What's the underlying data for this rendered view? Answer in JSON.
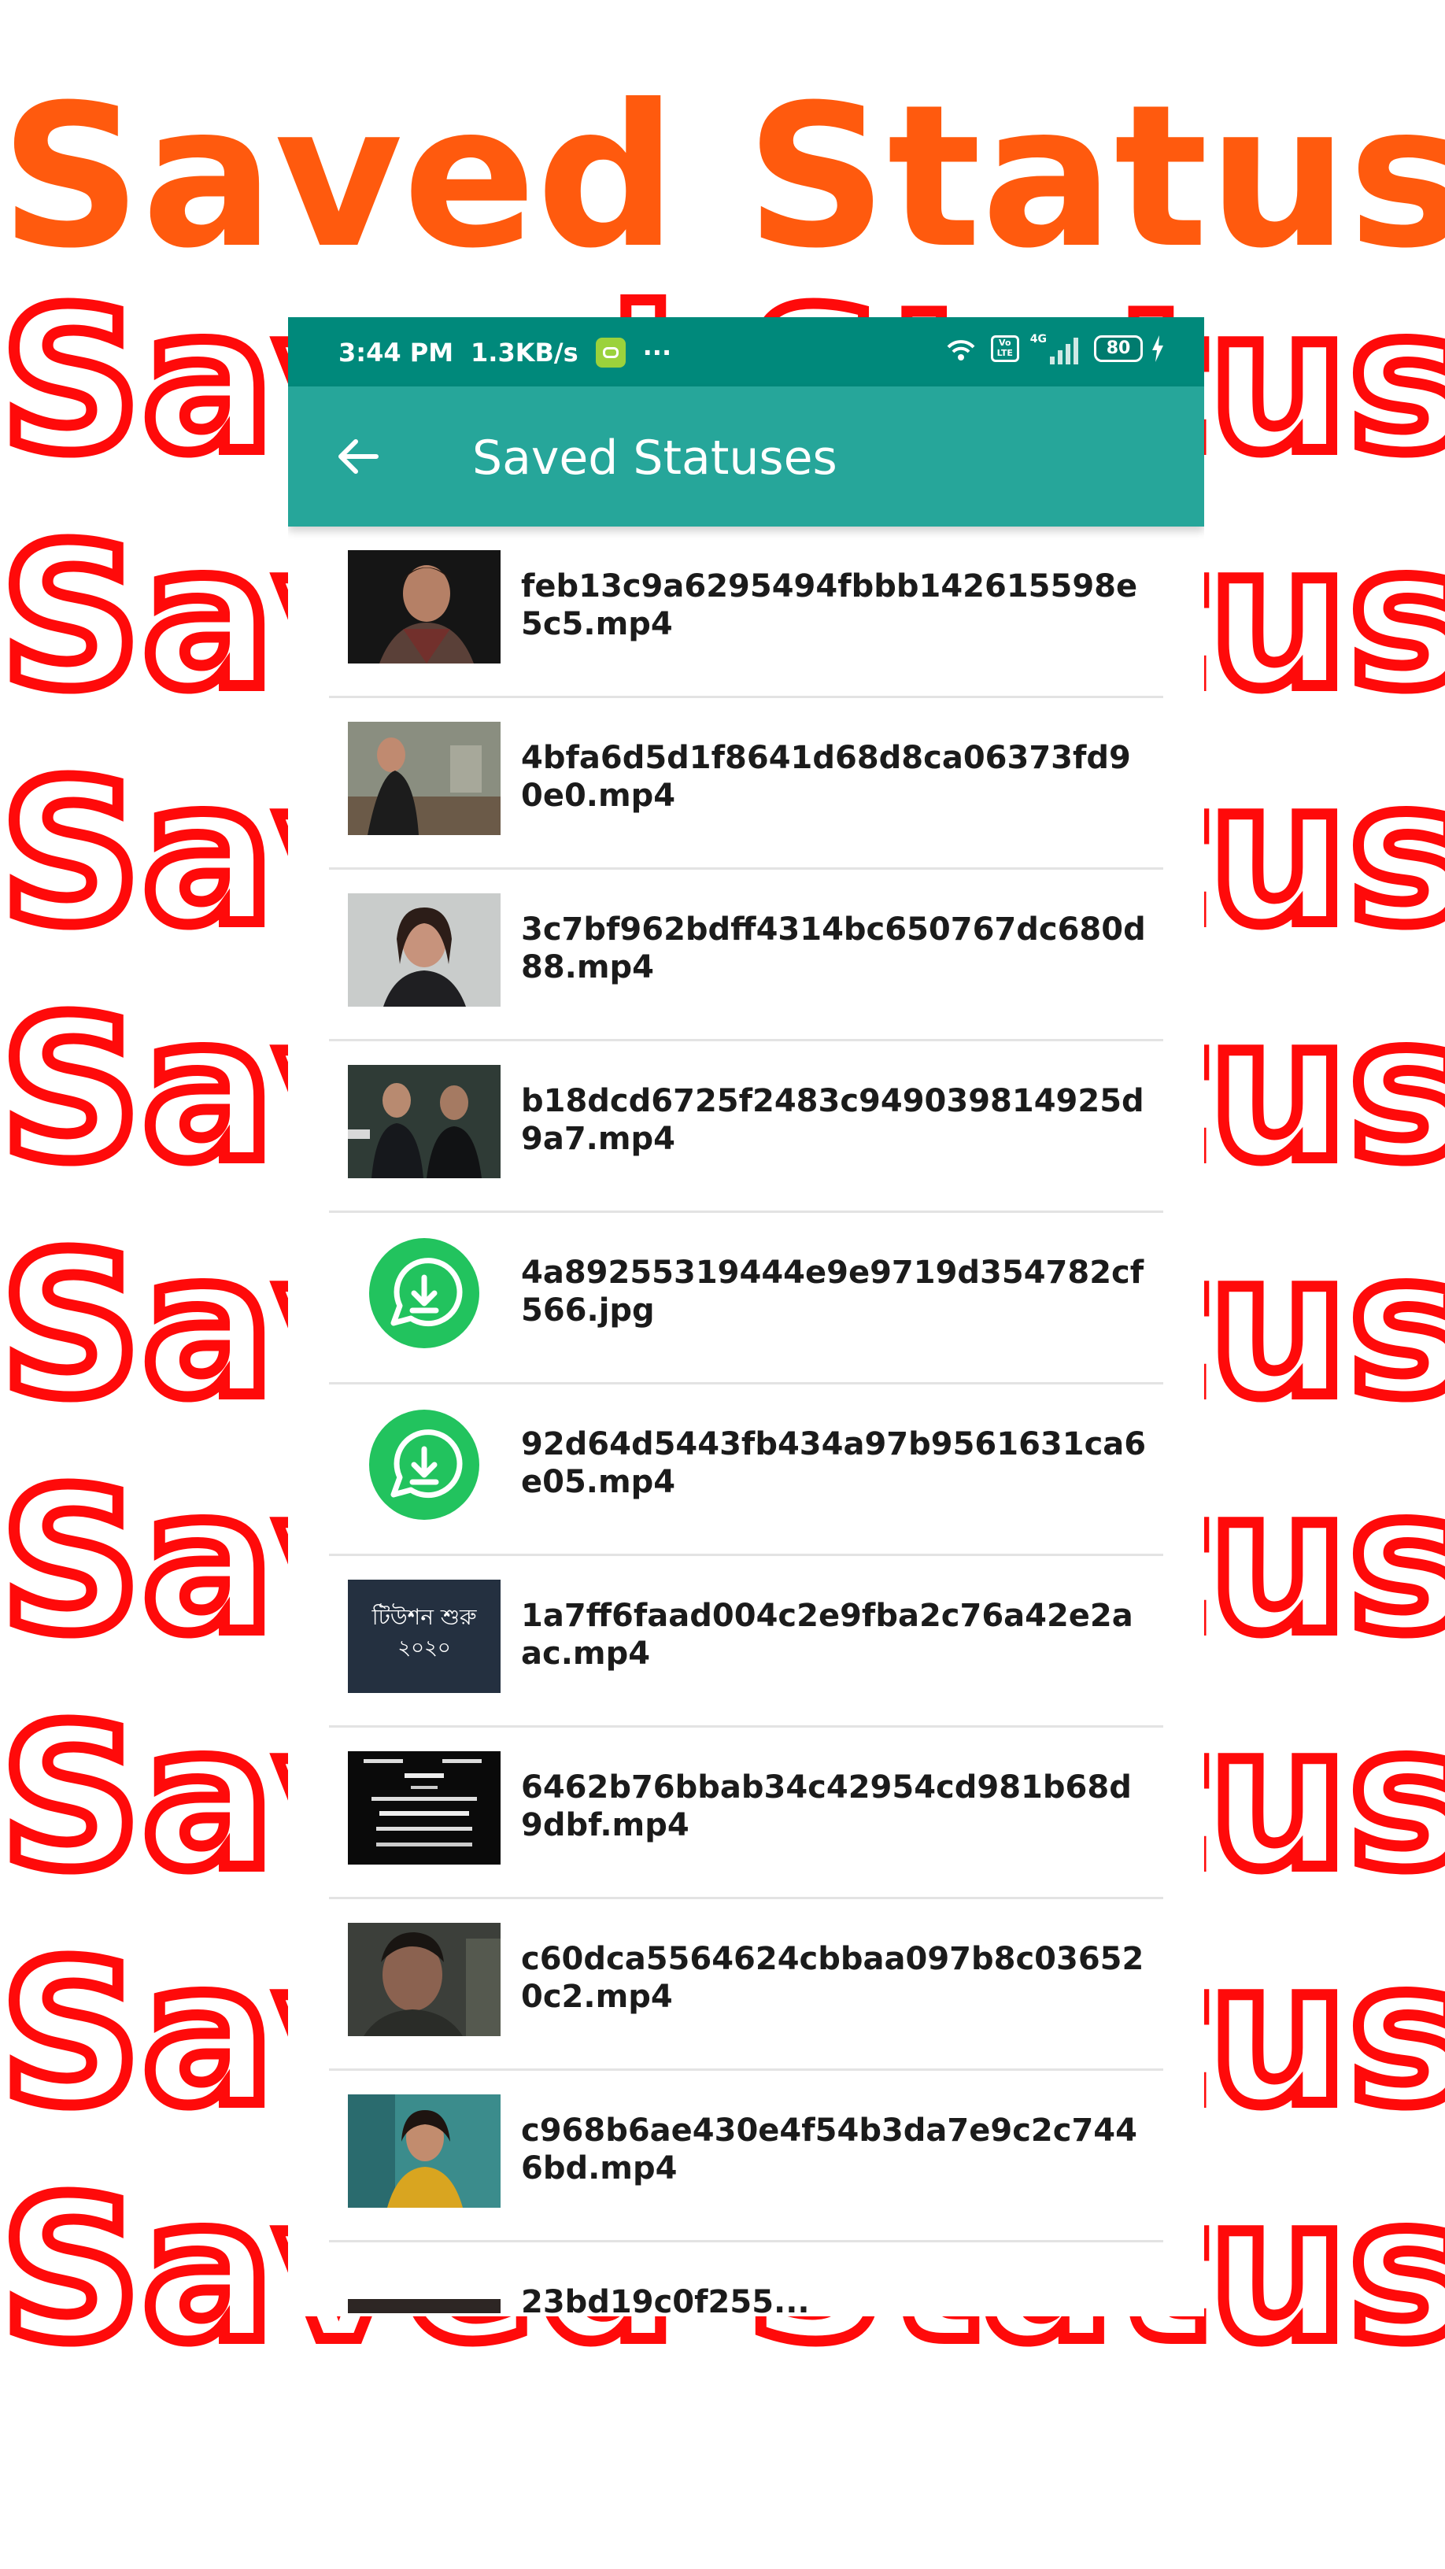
{
  "promo": {
    "title": "Saved Status",
    "background_text": "Saved Status",
    "title_color": "#FF5A0E",
    "outline_color": "#FF0A0A"
  },
  "status_bar": {
    "time": "3:44 PM",
    "speed": "1.3KB/s",
    "more": "···",
    "volte": "Vo LTE",
    "network": "4G",
    "battery": "80",
    "color": "#00897B"
  },
  "app_bar": {
    "title": "Saved Statuses",
    "color": "#26A69A"
  },
  "items": [
    {
      "name": "feb13c9a6295494fbbb142615598e5c5.mp4",
      "thumb": "man-portrait"
    },
    {
      "name": "4bfa6d5d1f8641d68d8ca06373fd90e0.mp4",
      "thumb": "woman-outdoor"
    },
    {
      "name": "3c7bf962bdff4314bc650767dc680d88.mp4",
      "thumb": "woman-talking"
    },
    {
      "name": "b18dcd6725f2483c949039814925d9a7.mp4",
      "thumb": "two-men"
    },
    {
      "name": "4a89255319444e9e9719d354782cf566.jpg",
      "thumb": "whatsapp-download-icon"
    },
    {
      "name": "92d64d5443fb434a97b9561631ca6e05.mp4",
      "thumb": "whatsapp-download-icon"
    },
    {
      "name": "1a7ff6faad004c2e9fba2c76a42e2aac.mp4",
      "thumb": "bengali-text-card",
      "thumb_text": [
        "টিউশন শুরু",
        "২০২০"
      ]
    },
    {
      "name": "6462b76bbab34c42954cd981b68d9dbf.mp4",
      "thumb": "notice-card"
    },
    {
      "name": "c60dca5564624cbbaa097b8c036520c2.mp4",
      "thumb": "man-closeup"
    },
    {
      "name": "c968b6ae430e4f54b3da7e9c2c7446bd.mp4",
      "thumb": "woman-teal-bg"
    },
    {
      "name": "23bd19c0f255...",
      "thumb": "partial"
    }
  ]
}
